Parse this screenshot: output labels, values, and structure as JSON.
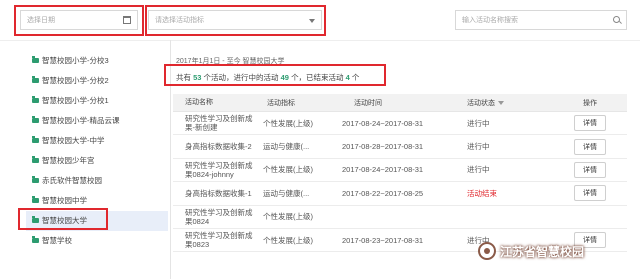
{
  "filters": {
    "date_placeholder": "选择日期",
    "activity_placeholder": "请选择活动指标",
    "search_placeholder": "输入活动名称搜索"
  },
  "sidebar": {
    "items": [
      {
        "label": "智慧校园小学-分校3"
      },
      {
        "label": "智慧校园小学-分校2"
      },
      {
        "label": "智慧校园小学-分校1"
      },
      {
        "label": "智慧校园小学-精品云课"
      },
      {
        "label": "智慧校园大学-中学"
      },
      {
        "label": "智慧校园少年宫"
      },
      {
        "label": "赤氏软件智慧校园"
      },
      {
        "label": "智慧校园中学"
      },
      {
        "label": "智慧校园大学"
      },
      {
        "label": "智慧学校"
      }
    ],
    "active_index": 8
  },
  "main": {
    "breadcrumb": "2017年1月1日 - 至今 智慧校园大学",
    "summary": {
      "prefix": "共有",
      "total": "53",
      "mid1": "个活动，进行中的活动",
      "ongoing": "49",
      "mid2": "个，已结束活动",
      "ended": "4",
      "suffix": "个"
    }
  },
  "table": {
    "headers": {
      "name": "活动名称",
      "indicator": "活动指标",
      "time": "活动时间",
      "status": "活动状态",
      "action": "操作"
    },
    "rows": [
      {
        "name": "研究性学习及创新成果-新创建",
        "indicator": "个性发展(上级)",
        "time": "2017-08-24~2017-08-31",
        "status": "进行中",
        "action": "详情"
      },
      {
        "name": "身高指标数据收集-2",
        "indicator": "运动与健康(...",
        "time": "2017-08-28~2017-08-31",
        "status": "进行中",
        "action": "详情"
      },
      {
        "name": "研究性学习及创新成果0824-johnny",
        "indicator": "个性发展(上级)",
        "time": "2017-08-24~2017-08-31",
        "status": "进行中",
        "action": "详情"
      },
      {
        "name": "身高指标数据收集-1",
        "indicator": "运动与健康(...",
        "time": "2017-08-22~2017-08-25",
        "status": "活动结束",
        "action": "详情"
      },
      {
        "name": "研究性学习及创新成果0824",
        "indicator": "个性发展(上级)",
        "time": "",
        "status": "",
        "action": ""
      },
      {
        "name": "研究性学习及创新成果0823",
        "indicator": "个性发展(上级)",
        "time": "2017-08-23~2017-08-31",
        "status": "进行中",
        "action": "详情"
      }
    ]
  },
  "watermark": {
    "text": "江苏省智慧校园"
  },
  "colors": {
    "accent_green": "#2d9c70",
    "annotation_red": "#e0282e",
    "ended_status": "#e0282e"
  }
}
